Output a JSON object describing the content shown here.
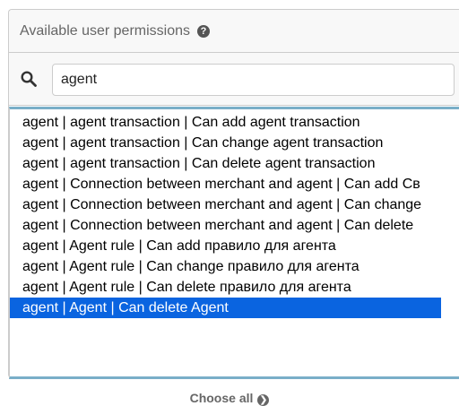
{
  "header": {
    "title": "Available user permissions",
    "help_icon": "question-circle-icon",
    "help_glyph": "?"
  },
  "filter": {
    "icon": "search-icon",
    "value": "agent"
  },
  "options": [
    {
      "label": "agent | agent transaction | Can add agent transaction",
      "selected": false
    },
    {
      "label": "agent | agent transaction | Can change agent transaction",
      "selected": false
    },
    {
      "label": "agent | agent transaction | Can delete agent transaction",
      "selected": false
    },
    {
      "label": "agent | Connection between merchant and agent | Can add Св",
      "selected": false
    },
    {
      "label": "agent | Connection between merchant and agent | Can change",
      "selected": false
    },
    {
      "label": "agent | Connection between merchant and agent | Can delete",
      "selected": false
    },
    {
      "label": "agent | Agent rule | Can add правило для агента",
      "selected": false
    },
    {
      "label": "agent | Agent rule | Can change правило для агента",
      "selected": false
    },
    {
      "label": "agent | Agent rule | Can delete правило для агента",
      "selected": false
    },
    {
      "label": "agent | Agent | Can delete Agent",
      "selected": true
    }
  ],
  "choose_all": {
    "label": "Choose all",
    "icon": "arrow-circle-right-icon",
    "glyph": "❯"
  },
  "colors": {
    "selected_bg": "#0a64e0",
    "focus_border": "#79aec8",
    "header_bg": "#f8f8f8"
  }
}
